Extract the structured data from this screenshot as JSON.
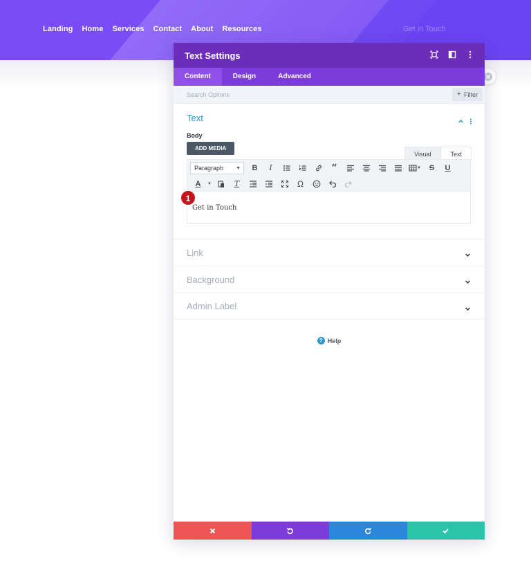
{
  "site": {
    "nav": [
      "Landing",
      "Home",
      "Services",
      "Contact",
      "About",
      "Resources"
    ],
    "cta": "Get in Touch"
  },
  "modal": {
    "title": "Text Settings",
    "tabs": [
      {
        "label": "Content",
        "active": true
      },
      {
        "label": "Design",
        "active": false
      },
      {
        "label": "Advanced",
        "active": false
      }
    ],
    "search_placeholder": "Search Options",
    "filter_label": "Filter",
    "text_section": {
      "title": "Text",
      "body_label": "Body",
      "add_media_label": "ADD MEDIA",
      "editor_tabs": [
        "Visual",
        "Text"
      ],
      "format_select": "Paragraph",
      "content": "Get in Touch"
    },
    "collapsed_sections": [
      "Link",
      "Background",
      "Admin Label"
    ],
    "help_label": "Help",
    "step_badge": "1"
  },
  "colors": {
    "header_bg": "#7a4cf5",
    "modal_header": "#6c2eb9",
    "tabs_bg": "#7d3bdb",
    "accent_blue": "#2e97c9",
    "footer_discard": "#ef5555",
    "footer_undo": "#7d3bdb",
    "footer_redo": "#2b87da",
    "footer_save": "#29c4a9",
    "badge": "#c3151b"
  },
  "icons": {
    "header": [
      "expand-icon",
      "split-view-icon",
      "more-options-icon"
    ],
    "footer": [
      "discard-icon",
      "undo-icon",
      "redo-icon",
      "save-check-icon"
    ]
  }
}
